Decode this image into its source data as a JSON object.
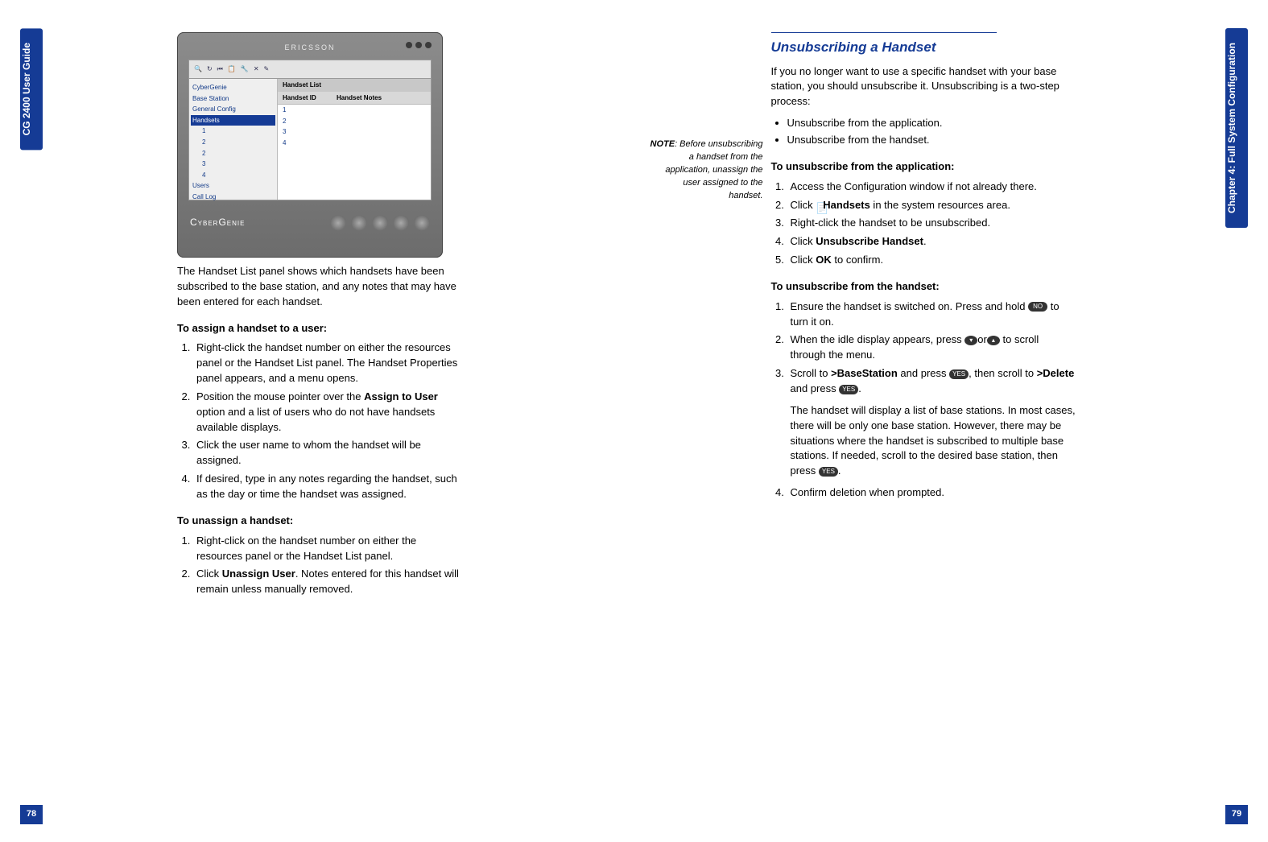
{
  "left": {
    "side_tab": "CG 2400 User Guide",
    "page_number": "78",
    "screenshot": {
      "titlebar": "ERICSSON",
      "toolbar_icons": [
        "🔍",
        "↻",
        "⏮",
        "📋",
        "🔧",
        "✕",
        "✎"
      ],
      "tree": [
        "CyberGenie",
        "Base Station",
        "General Config",
        "Handsets",
        " 1",
        " 2",
        " 2",
        " 3",
        " 4",
        "Users",
        "Call Log"
      ],
      "tree_selected_index": 3,
      "list_header_title": "Handset List",
      "list_columns": [
        "Handset ID",
        "Handset Notes"
      ],
      "list_rows": [
        [
          "1",
          ""
        ],
        [
          "2",
          ""
        ],
        [
          "3",
          ""
        ],
        [
          "4",
          ""
        ]
      ],
      "footer_brand": "CyberGenie"
    },
    "intro": "The Handset List panel shows which handsets have been subscribed to the base station, and any notes that may have been entered for each handset.",
    "assign_head": "To assign a handset to a user:",
    "assign_steps": [
      "Right-click the handset number on either the resources panel or the Handset List panel. The Handset Properties panel appears, and a menu opens.",
      {
        "pre": "Position the mouse pointer over the ",
        "bold": "Assign to User",
        "post": " option and a list of users who do not have handsets available displays."
      },
      "Click the user name to whom the handset will be assigned.",
      "If desired, type in any notes regarding the handset, such as the day or time the handset was assigned."
    ],
    "unassign_head": "To unassign a handset:",
    "unassign_steps": [
      "Right-click on the handset number on either the resources panel or the Handset List panel.",
      {
        "pre": "Click ",
        "bold": "Unassign User",
        "post": ". Notes entered for this handset will remain unless manually removed."
      }
    ]
  },
  "right": {
    "side_tab": "Chapter 4: Full System Configuration",
    "page_number": "79",
    "section_title": "Unsubscribing a Handset",
    "margin_note": {
      "label": "NOTE",
      "text": ": Before unsubscribing a handset from the application, unassign the user assigned to the handset."
    },
    "intro": "If you no longer want to use a specific handset with your base station, you should unsubscribe it. Unsubscribing is a two-step process:",
    "bullets": [
      "Unsubscribe from the application.",
      "Unsubscribe from the handset."
    ],
    "app_head": "To unsubscribe from the application:",
    "app_steps": [
      "Access the Configuration window if not already there.",
      {
        "pre": "Click ",
        "icon": "📄",
        "bold": "Handsets",
        "post": " in the system resources area."
      },
      "Right-click the handset to be unsubscribed.",
      {
        "pre": "Click ",
        "bold": "Unsubscribe Handset",
        "post": "."
      },
      {
        "pre": "Click ",
        "bold": "OK",
        "post": " to confirm."
      }
    ],
    "hs_head": "To unsubscribe from the handset:",
    "hs_steps": [
      {
        "text1": "Ensure the handset is switched on. Press and hold ",
        "key1": "NO",
        "text2": " to turn it on."
      },
      {
        "text1": "When the idle display appears, press ",
        "arrow1": "▾",
        "mid": "or",
        "arrow2": "▴",
        "text2": " to scroll through the menu."
      },
      {
        "text1": "Scroll to ",
        "bold1": ">BaseStation",
        "text2": " and press ",
        "key1": "YES",
        "text3": ", then scroll to ",
        "bold2": ">Delete",
        "text4": " and press ",
        "key2": "YES",
        "text5": "."
      },
      "Confirm deletion when prompted."
    ],
    "hs_step3_note": {
      "text1": "The handset will display a list of base stations. In most cases, there will be only one base station. However, there may be situations where the handset is subscribed to multiple base stations. If needed, scroll to the desired base station, then press ",
      "key": "YES",
      "text2": "."
    }
  }
}
